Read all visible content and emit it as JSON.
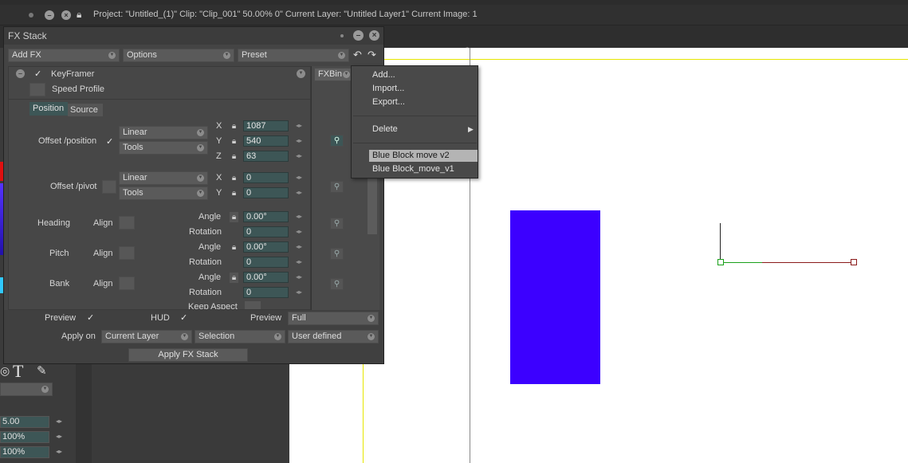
{
  "status": {
    "info": "Project:  \"Untitled_(1)\"  Clip: \"Clip_001\"   50.00%   0\"  Current Layer: \"Untitled Layer1\"  Current Image: 1"
  },
  "left_panel": {
    "fields": [
      {
        "value": "5.00"
      },
      {
        "value": "100%"
      },
      {
        "value": "100%"
      }
    ],
    "text_tool_glyph": "T"
  },
  "fx_stack": {
    "title": "FX Stack",
    "toolbar": {
      "add_fx": "Add FX",
      "options": "Options",
      "preset": "Preset"
    },
    "effect_name": "KeyFramer",
    "speed_profile": "Speed Profile",
    "tabs": {
      "position": "Position",
      "source": "Source"
    },
    "fxbin": "FXBin",
    "offset_position": {
      "label": "Offset /position",
      "interp": "Linear",
      "tools": "Tools",
      "x_label": "X",
      "y_label": "Y",
      "z_label": "Z",
      "x": "1087",
      "y": "540",
      "z": "63"
    },
    "offset_pivot": {
      "label": "Offset /pivot",
      "interp": "Linear",
      "tools": "Tools",
      "x_label": "X",
      "y_label": "Y",
      "x": "0",
      "y": "0"
    },
    "rotations": [
      {
        "label": "Heading",
        "align": "Align",
        "angle_label": "Angle",
        "angle": "0.00°",
        "rot_label": "Rotation",
        "rot": "0"
      },
      {
        "label": "Pitch",
        "align": "Align",
        "angle_label": "Angle",
        "angle": "0.00°",
        "rot_label": "Rotation",
        "rot": "0"
      },
      {
        "label": "Bank",
        "align": "Align",
        "angle_label": "Angle",
        "angle": "0.00°",
        "rot_label": "Rotation",
        "rot": "0"
      }
    ],
    "keep_aspect": "Keep Aspect",
    "footer": {
      "preview_label": "Preview",
      "hud_label": "HUD",
      "preview_right_label": "Preview",
      "preview_mode": "Full",
      "apply_on_label": "Apply on",
      "apply_layer": "Current Layer",
      "apply_selection": "Selection",
      "apply_user": "User defined",
      "apply_button": "Apply FX Stack"
    }
  },
  "context_menu": {
    "items": [
      "Add...",
      "Import...",
      "Export..."
    ],
    "delete": "Delete",
    "presets": [
      "Blue Block move v2",
      "Blue Block_move_v1"
    ]
  },
  "colors": {
    "blue_block": "#3c00ff",
    "guide_yellow": "#e6e600",
    "path_green": "#1aa01a",
    "path_red": "#8a1a1a"
  }
}
